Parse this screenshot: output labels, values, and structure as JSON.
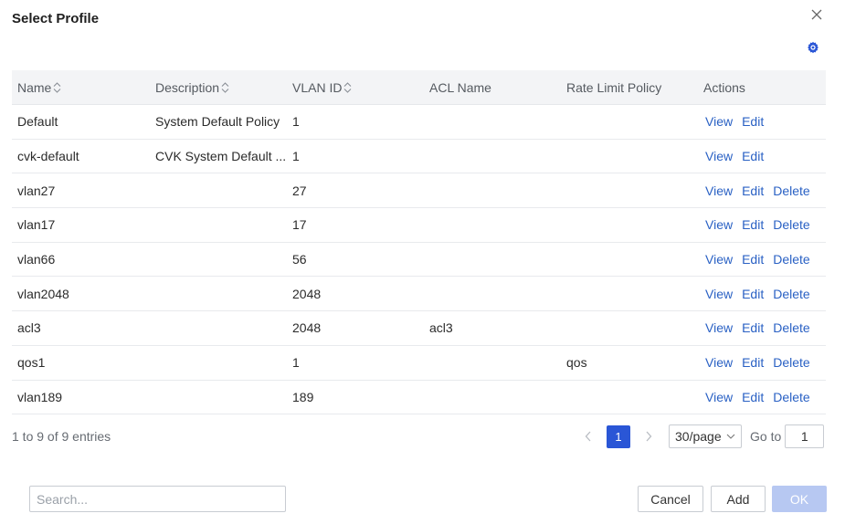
{
  "dialog": {
    "title": "Select Profile"
  },
  "table": {
    "columns": {
      "name": "Name",
      "description": "Description",
      "vlan_id": "VLAN ID",
      "acl_name": "ACL Name",
      "rate_limit_policy": "Rate Limit Policy",
      "actions": "Actions"
    },
    "rows": [
      {
        "name": "Default",
        "description": "System Default Policy",
        "vlan_id": "1",
        "acl_name": "",
        "rate_limit_policy": "",
        "actions": [
          "View",
          "Edit"
        ]
      },
      {
        "name": "cvk-default",
        "description": "CVK System Default ...",
        "vlan_id": "1",
        "acl_name": "",
        "rate_limit_policy": "",
        "actions": [
          "View",
          "Edit"
        ]
      },
      {
        "name": "vlan27",
        "description": "",
        "vlan_id": "27",
        "acl_name": "",
        "rate_limit_policy": "",
        "actions": [
          "View",
          "Edit",
          "Delete"
        ]
      },
      {
        "name": "vlan17",
        "description": "",
        "vlan_id": "17",
        "acl_name": "",
        "rate_limit_policy": "",
        "actions": [
          "View",
          "Edit",
          "Delete"
        ]
      },
      {
        "name": "vlan66",
        "description": "",
        "vlan_id": "56",
        "acl_name": "",
        "rate_limit_policy": "",
        "actions": [
          "View",
          "Edit",
          "Delete"
        ]
      },
      {
        "name": "vlan2048",
        "description": "",
        "vlan_id": "2048",
        "acl_name": "",
        "rate_limit_policy": "",
        "actions": [
          "View",
          "Edit",
          "Delete"
        ]
      },
      {
        "name": "acl3",
        "description": "",
        "vlan_id": "2048",
        "acl_name": "acl3",
        "rate_limit_policy": "",
        "actions": [
          "View",
          "Edit",
          "Delete"
        ]
      },
      {
        "name": "qos1",
        "description": "",
        "vlan_id": "1",
        "acl_name": "",
        "rate_limit_policy": "qos",
        "actions": [
          "View",
          "Edit",
          "Delete"
        ]
      },
      {
        "name": "vlan189",
        "description": "",
        "vlan_id": "189",
        "acl_name": "",
        "rate_limit_policy": "",
        "actions": [
          "View",
          "Edit",
          "Delete"
        ]
      }
    ]
  },
  "pagination": {
    "summary": "1 to 9 of 9 entries",
    "current_page": "1",
    "page_size": "30/page",
    "goto_label": "Go to",
    "goto_value": "1"
  },
  "footer": {
    "search_placeholder": "Search...",
    "cancel_label": "Cancel",
    "add_label": "Add",
    "ok_label": "OK"
  },
  "colors": {
    "link": "#2a61c4",
    "primary": "#2a56d6",
    "ok_disabled": "#b7c8f2",
    "header_bg": "#f3f4f6"
  },
  "icons": {
    "close": "close-icon",
    "settings": "gear-icon",
    "sort": "sort-icon",
    "prev": "chevron-left-icon",
    "next": "chevron-right-icon",
    "dropdown": "chevron-down-icon"
  }
}
